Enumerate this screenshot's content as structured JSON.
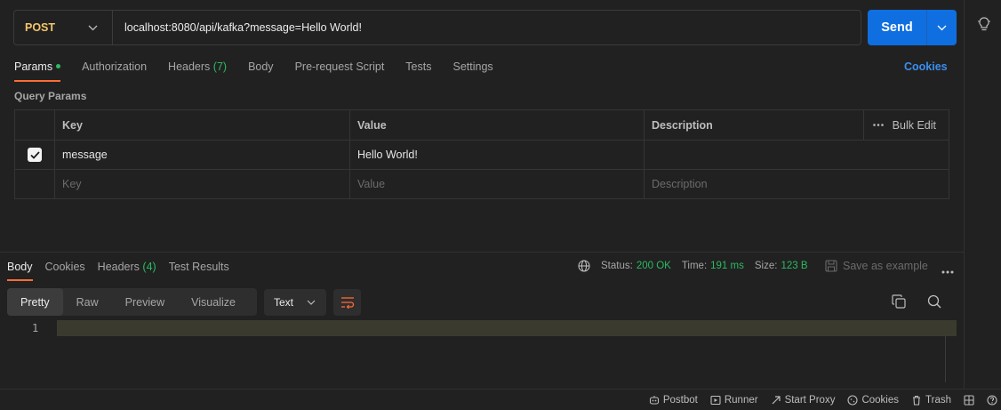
{
  "request": {
    "method": "POST",
    "url": "localhost:8080/api/kafka?message=Hello World!",
    "send_label": "Send"
  },
  "request_tabs": [
    {
      "label": "Params",
      "active": true,
      "dot": true
    },
    {
      "label": "Authorization"
    },
    {
      "label": "Headers",
      "count": "(7)"
    },
    {
      "label": "Body"
    },
    {
      "label": "Pre-request Script"
    },
    {
      "label": "Tests"
    },
    {
      "label": "Settings"
    }
  ],
  "cookies_link": "Cookies",
  "query_params": {
    "title": "Query Params",
    "headers": {
      "key": "Key",
      "value": "Value",
      "description": "Description",
      "bulk_edit": "Bulk Edit"
    },
    "rows": [
      {
        "checked": true,
        "key": "message",
        "value": "Hello World!",
        "description": ""
      }
    ],
    "placeholders": {
      "key": "Key",
      "value": "Value",
      "description": "Description"
    }
  },
  "response_tabs": [
    {
      "label": "Body",
      "active": true
    },
    {
      "label": "Cookies"
    },
    {
      "label": "Headers",
      "count": "(4)"
    },
    {
      "label": "Test Results"
    }
  ],
  "response_status": {
    "status_label": "Status:",
    "status_value": "200 OK",
    "time_label": "Time:",
    "time_value": "191 ms",
    "size_label": "Size:",
    "size_value": "123 B",
    "save_example": "Save as example"
  },
  "view_modes": [
    "Pretty",
    "Raw",
    "Preview",
    "Visualize"
  ],
  "format_select": "Text",
  "editor": {
    "line_number": "1"
  },
  "footer": {
    "postbot": "Postbot",
    "runner": "Runner",
    "start_proxy": "Start Proxy",
    "cookies": "Cookies",
    "trash": "Trash"
  },
  "colors": {
    "accent_orange": "#ff6c37",
    "send_blue": "#0f6fe0",
    "method_yellow": "#f5c66a",
    "status_green": "#2bba62"
  }
}
